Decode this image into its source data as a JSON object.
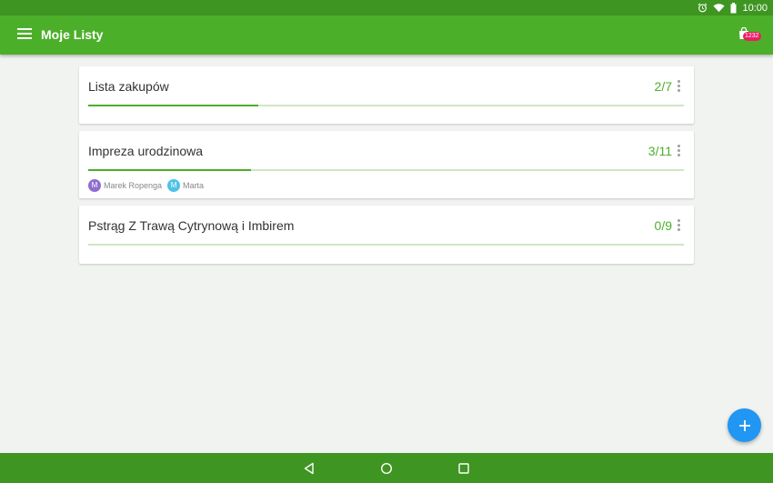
{
  "status_bar": {
    "time": "10:00",
    "icons": [
      "alarm-icon",
      "wifi-icon",
      "battery-icon"
    ]
  },
  "app_bar": {
    "title": "Moje Listy",
    "menu_icon": "hamburger-menu-icon",
    "cart_icon": "shopping-bag-icon",
    "badge": "1232"
  },
  "lists": [
    {
      "title": "Lista zakupów",
      "count": "2/7",
      "progress": 0.286,
      "collaborators": []
    },
    {
      "title": "Impreza urodzinowa",
      "count": "3/11",
      "progress": 0.273,
      "collaborators": [
        {
          "name": "Marek Ropenga",
          "initial": "M",
          "color": "#8e6fd0"
        },
        {
          "name": "Marta",
          "initial": "M",
          "color": "#4ec3e6"
        }
      ]
    },
    {
      "title": "Pstrąg Z Trawą Cytrynową i Imbirem",
      "count": "0/9",
      "progress": 0.0,
      "collaborators": []
    }
  ],
  "fab": {
    "icon": "plus-icon"
  },
  "nav_bar": {
    "icons": [
      "back-icon",
      "home-icon",
      "recents-icon"
    ]
  },
  "colors": {
    "primary": "#4caf2a",
    "primary_dark": "#3e9521",
    "accent": "#2196f3",
    "badge": "#e91e63"
  }
}
